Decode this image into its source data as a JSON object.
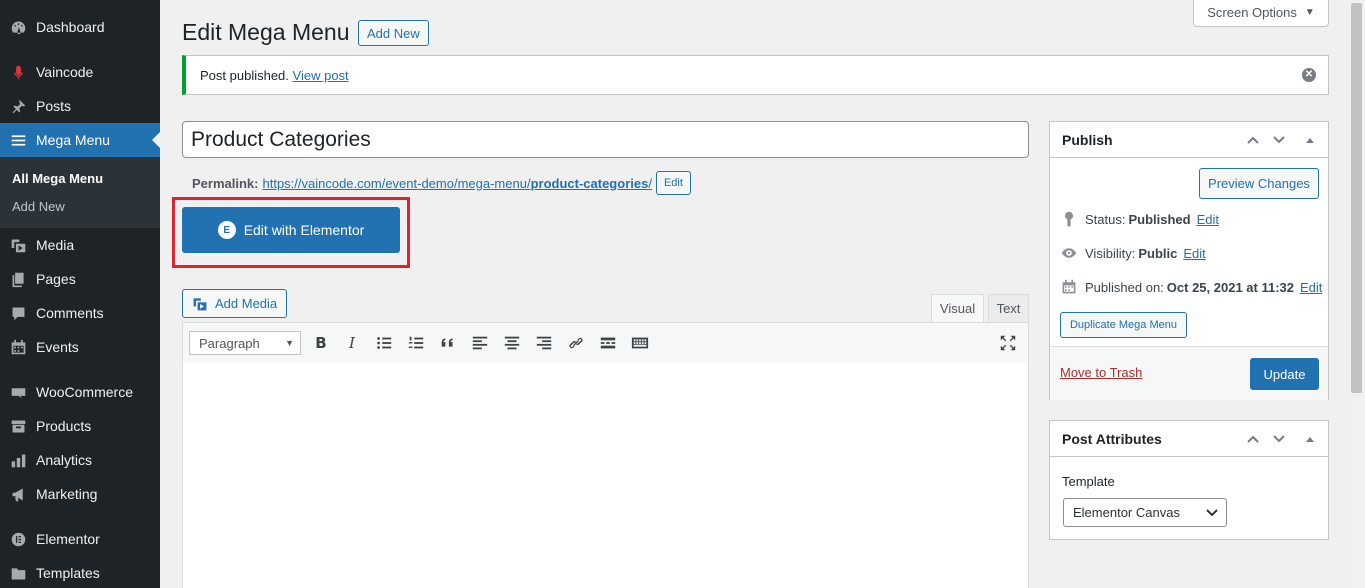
{
  "sidebar": {
    "items": [
      {
        "label": "Dashboard",
        "icon": "dashboard-icon"
      },
      {
        "label": "Vaincode",
        "icon": "microphone-icon"
      },
      {
        "label": "Posts",
        "icon": "pin-icon"
      },
      {
        "label": "Mega Menu",
        "icon": "menu-icon"
      },
      {
        "label": "Media",
        "icon": "media-icon"
      },
      {
        "label": "Pages",
        "icon": "pages-icon"
      },
      {
        "label": "Comments",
        "icon": "comments-icon"
      },
      {
        "label": "Events",
        "icon": "calendar-icon"
      },
      {
        "label": "WooCommerce",
        "icon": "woo-icon"
      },
      {
        "label": "Products",
        "icon": "archive-icon"
      },
      {
        "label": "Analytics",
        "icon": "bar-chart-icon"
      },
      {
        "label": "Marketing",
        "icon": "megaphone-icon"
      },
      {
        "label": "Elementor",
        "icon": "elementor-icon"
      },
      {
        "label": "Templates",
        "icon": "folder-icon"
      }
    ],
    "submenu": {
      "all": "All Mega Menu",
      "add_new": "Add New"
    },
    "active_color": "#2271b1"
  },
  "screen_options": {
    "label": "Screen Options"
  },
  "header": {
    "title": "Edit Mega Menu",
    "add_new": "Add New"
  },
  "notice": {
    "text": "Post published.",
    "link": "View post"
  },
  "post": {
    "title": "Product Categories",
    "permalink_label": "Permalink:",
    "permalink_base": "https://vaincode.com/event-demo/mega-menu/",
    "permalink_slug": "product-categories",
    "permalink_trailing": "/",
    "permalink_edit": "Edit"
  },
  "elementor": {
    "button": "Edit with Elementor",
    "icon_glyph": "E"
  },
  "editor": {
    "add_media": "Add Media",
    "tabs": {
      "visual": "Visual",
      "text": "Text"
    },
    "format": "Paragraph",
    "bold": "B",
    "italic": "I"
  },
  "publish": {
    "title": "Publish",
    "preview": "Preview Changes",
    "status_label": "Status:",
    "status_value": "Published",
    "status_edit": "Edit",
    "visibility_label": "Visibility:",
    "visibility_value": "Public",
    "visibility_edit": "Edit",
    "published_label": "Published on:",
    "published_value": "Oct 25, 2021 at 11:32",
    "published_edit": "Edit",
    "duplicate": "Duplicate Mega Menu",
    "trash": "Move to Trash",
    "update": "Update"
  },
  "attributes": {
    "title": "Post Attributes",
    "template_label": "Template",
    "template_value": "Elementor Canvas"
  },
  "colors": {
    "notice_success": "#00a32a",
    "highlight": "#e0232e",
    "trash": "#b32d2e"
  }
}
